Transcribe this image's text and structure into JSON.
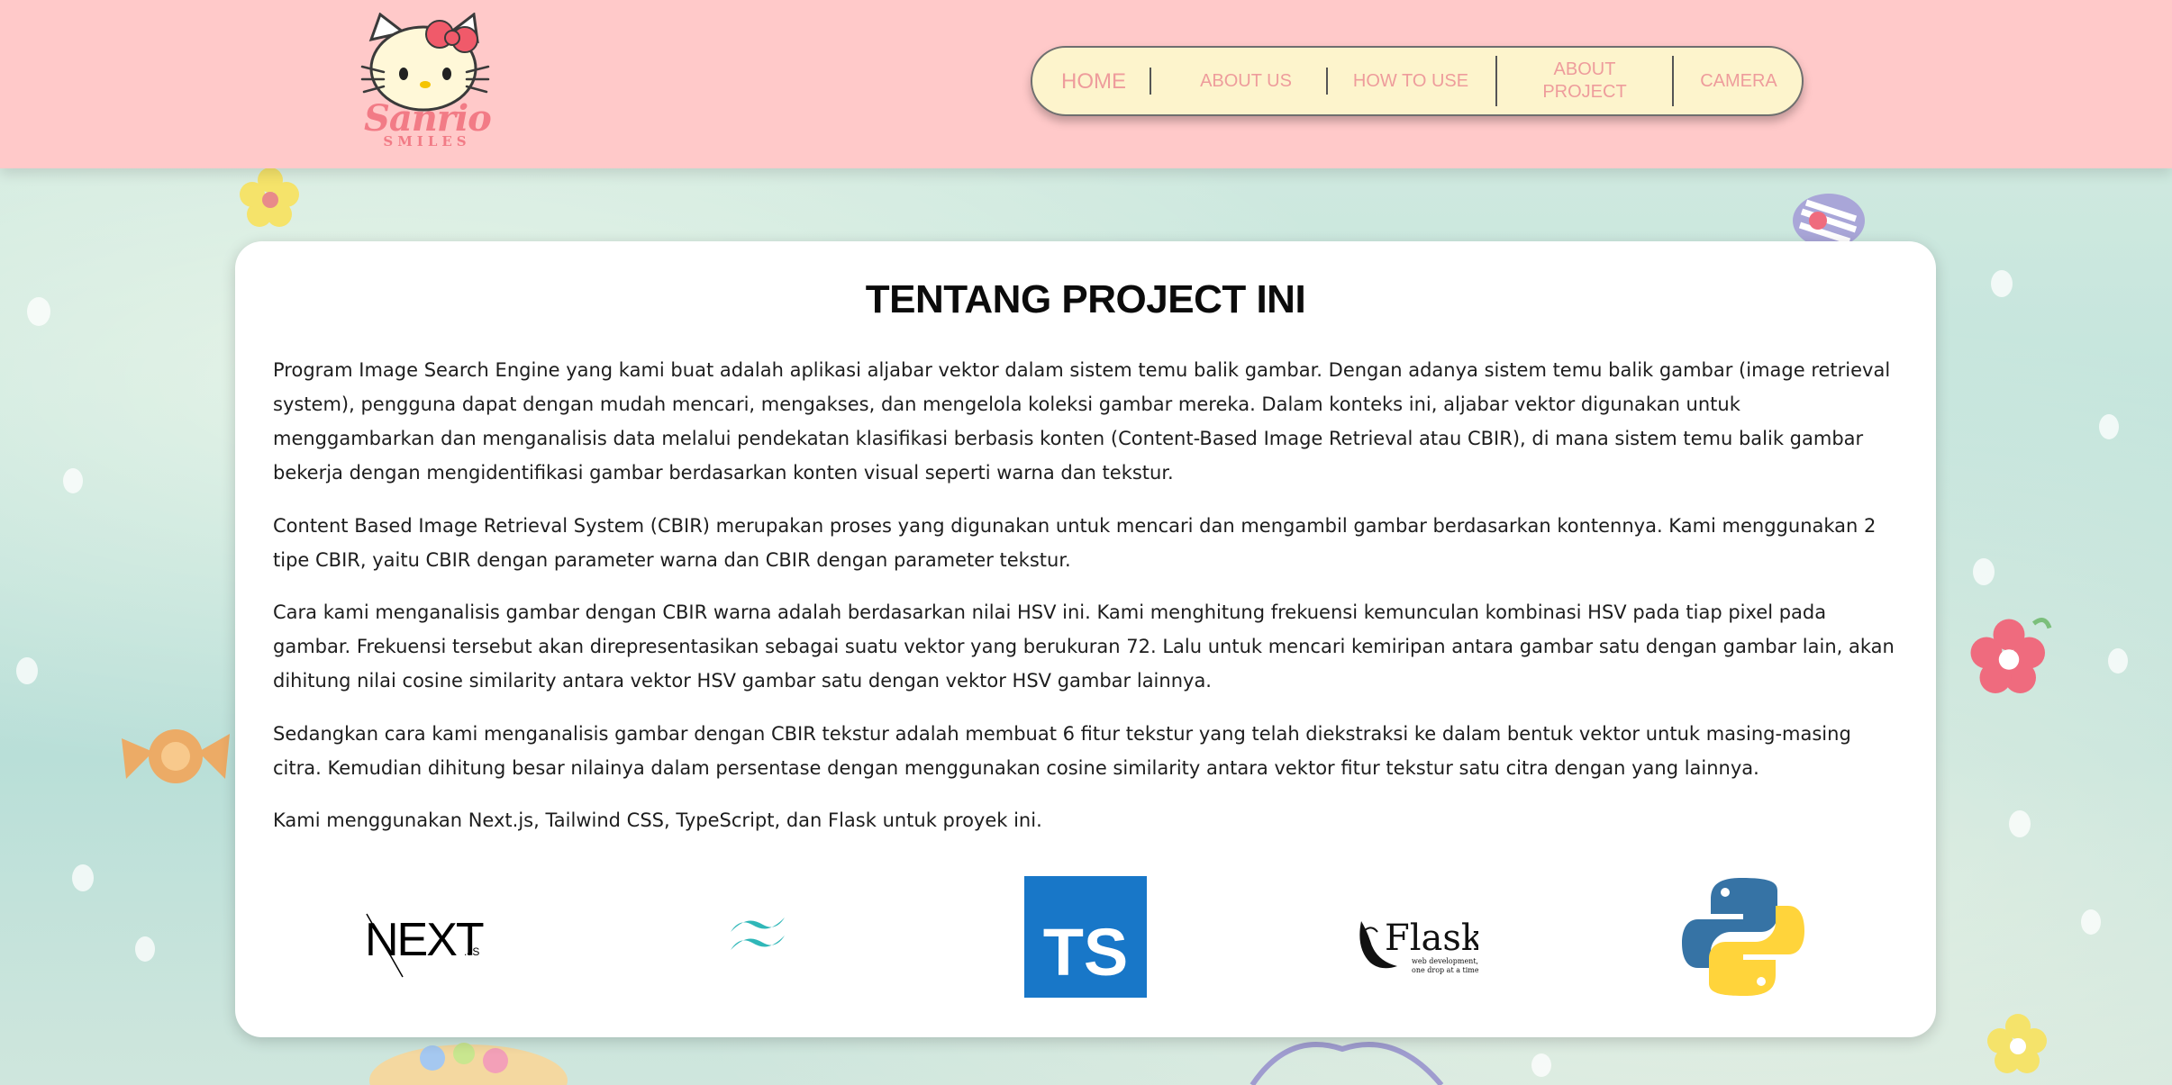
{
  "colors": {
    "header_bg": "#ffc9c9",
    "nav_bg": "#fdf4cc",
    "nav_text": "#ee9c9c",
    "card_bg": "#ffffff",
    "logo_pink": "#f27b86",
    "ts_blue": "#1877c8",
    "tailwind_teal": "#2fb7b8"
  },
  "brand": {
    "logo_text": "Sanrio",
    "logo_subtext": "SMILES",
    "logo_icon": "hello-kitty-icon"
  },
  "nav": {
    "items": [
      {
        "label": "HOME"
      },
      {
        "label": "ABOUT US"
      },
      {
        "label": "HOW TO USE"
      },
      {
        "label": "ABOUT\nPROJECT"
      },
      {
        "label": "CAMERA"
      }
    ]
  },
  "content": {
    "title": "TENTANG PROJECT INI",
    "paragraphs": [
      "Program Image Search Engine yang kami buat adalah aplikasi aljabar vektor dalam sistem temu balik gambar. Dengan adanya sistem temu balik gambar (image retrieval system), pengguna dapat dengan mudah mencari, mengakses, dan mengelola koleksi gambar mereka. Dalam konteks ini, aljabar vektor digunakan untuk menggambarkan dan menganalisis data melalui pendekatan klasifikasi berbasis konten (Content-Based Image Retrieval atau CBIR), di mana sistem temu balik gambar bekerja dengan mengidentifikasi gambar berdasarkan konten visual seperti warna dan tekstur.",
      "Content Based Image Retrieval System (CBIR) merupakan proses yang digunakan untuk mencari dan mengambil gambar berdasarkan kontennya. Kami menggunakan 2 tipe CBIR, yaitu CBIR dengan parameter warna dan CBIR dengan parameter tekstur.",
      "Cara kami menganalisis gambar dengan CBIR warna adalah berdasarkan nilai HSV ini. Kami menghitung frekuensi kemunculan kombinasi HSV pada tiap pixel pada gambar. Frekuensi tersebut akan direpresentasikan sebagai suatu vektor yang berukuran 72. Lalu untuk mencari kemiripan antara gambar satu dengan gambar lain, akan dihitung nilai cosine similarity antara vektor HSV gambar satu dengan vektor HSV gambar lainnya.",
      "Sedangkan cara kami menganalisis gambar dengan CBIR tekstur adalah membuat 6 fitur tekstur yang telah diekstraksi ke dalam bentuk vektor untuk masing-masing citra. Kemudian dihitung besar nilainya dalam persentase dengan menggunakan cosine similarity antara vektor fitur tekstur satu citra dengan yang lainnya.",
      "Kami menggunakan Next.js, Tailwind CSS, TypeScript, dan Flask untuk proyek ini."
    ]
  },
  "tech_logos": {
    "next": {
      "icon": "nextjs-logo",
      "text": "NEXT",
      "suffix": ".JS"
    },
    "tailwind": {
      "icon": "tailwind-logo"
    },
    "typescript": {
      "icon": "typescript-logo",
      "text": "TS"
    },
    "flask": {
      "icon": "flask-logo",
      "text": "Flask",
      "tagline_1": "web development,",
      "tagline_2": "one drop at a time"
    },
    "python": {
      "icon": "python-logo"
    }
  }
}
